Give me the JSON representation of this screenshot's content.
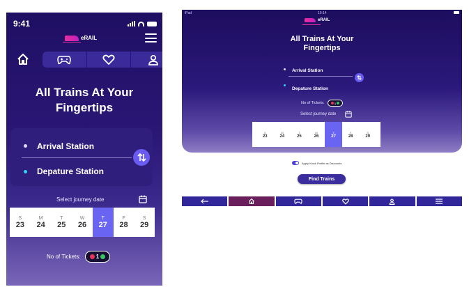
{
  "phone": {
    "status": {
      "time": "9:41"
    },
    "brand": "eRAIL",
    "nav_icons": [
      "home-icon",
      "gamepad-icon",
      "heart-icon",
      "user-icon"
    ],
    "title_line1": "All Trains At Your",
    "title_line2": "Fingertips",
    "arrival_label": "Arrival Station",
    "departure_label": "Depature Station",
    "select_date_label": "Select journey date",
    "calendar": [
      {
        "w": "S",
        "n": "23"
      },
      {
        "w": "M",
        "n": "24"
      },
      {
        "w": "T",
        "n": "25"
      },
      {
        "w": "W",
        "n": "26"
      },
      {
        "w": "T",
        "n": "27",
        "selected": true
      },
      {
        "w": "F",
        "n": "28"
      },
      {
        "w": "S",
        "n": "29"
      }
    ],
    "tickets_label": "No of Tickets:",
    "tickets_count": "1"
  },
  "tablet": {
    "status": {
      "left": "iPad",
      "time": "10:14"
    },
    "brand": "eRAIL",
    "title_line1": "All Trains At Your",
    "title_line2": "Fingertips",
    "arrival_label": "Arrival Station",
    "departure_label": "Depature Station",
    "tickets_label": "No of Tickets:",
    "tickets_count": "1",
    "select_date_label": "Select journey date",
    "calendar": [
      {
        "w": "S",
        "n": "23"
      },
      {
        "w": "M",
        "n": "24"
      },
      {
        "w": "T",
        "n": "25"
      },
      {
        "w": "W",
        "n": "26"
      },
      {
        "w": "T",
        "n": "27",
        "selected": true
      },
      {
        "w": "F",
        "n": "28"
      },
      {
        "w": "S",
        "n": "29"
      }
    ],
    "agree_label": "Apply Kiosk Profile as Discounts",
    "find_button": "Find Trains",
    "bottom_nav_icons": [
      "arrow-left-icon",
      "home-icon",
      "gamepad-icon",
      "heart-icon",
      "user-icon",
      "menu-icon"
    ]
  },
  "colors": {
    "accent": "#6a64f2",
    "brand_pink": "#e62e9e",
    "navy": "#1f0f63",
    "minus": "#e7355b",
    "plus": "#3ac266"
  }
}
